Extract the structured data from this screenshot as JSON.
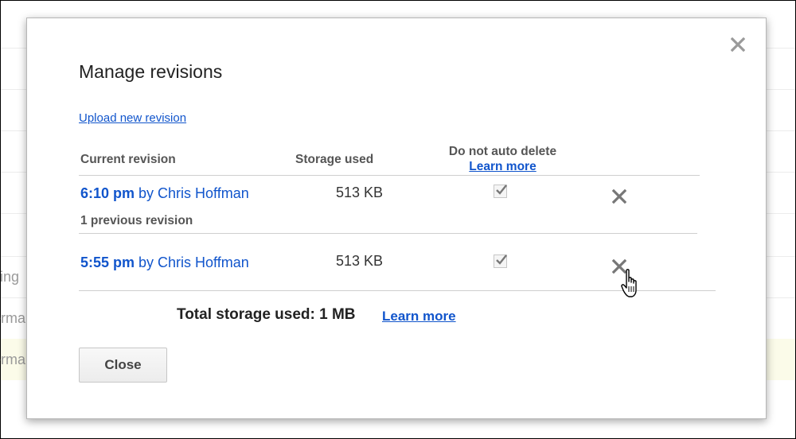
{
  "background": {
    "fragments": [
      "ing",
      "erma",
      "erma"
    ]
  },
  "dialog": {
    "title": "Manage revisions",
    "close_icon": "close-icon",
    "upload_link": "Upload new revision",
    "columns": {
      "current": "Current revision",
      "storage": "Storage used",
      "no_auto_delete": "Do not auto delete",
      "no_auto_delete_learn": "Learn more"
    },
    "revisions": [
      {
        "time": "6:10 pm",
        "by": " by Chris Hoffman",
        "size": "513 KB",
        "keep_forever": true,
        "delete_icon": "delete-x-icon"
      },
      {
        "time": "5:55 pm",
        "by": " by Chris Hoffman",
        "size": "513 KB",
        "keep_forever": true,
        "delete_icon": "delete-x-icon"
      }
    ],
    "previous_revision_note": "1 previous revision",
    "total_label": "Total storage used: 1 MB",
    "total_learn": "Learn more",
    "close_button": "Close"
  },
  "colors": {
    "link": "#1155cc",
    "dialog_border": "#b7b7b7",
    "highlight_row": "#fbfbe9"
  }
}
